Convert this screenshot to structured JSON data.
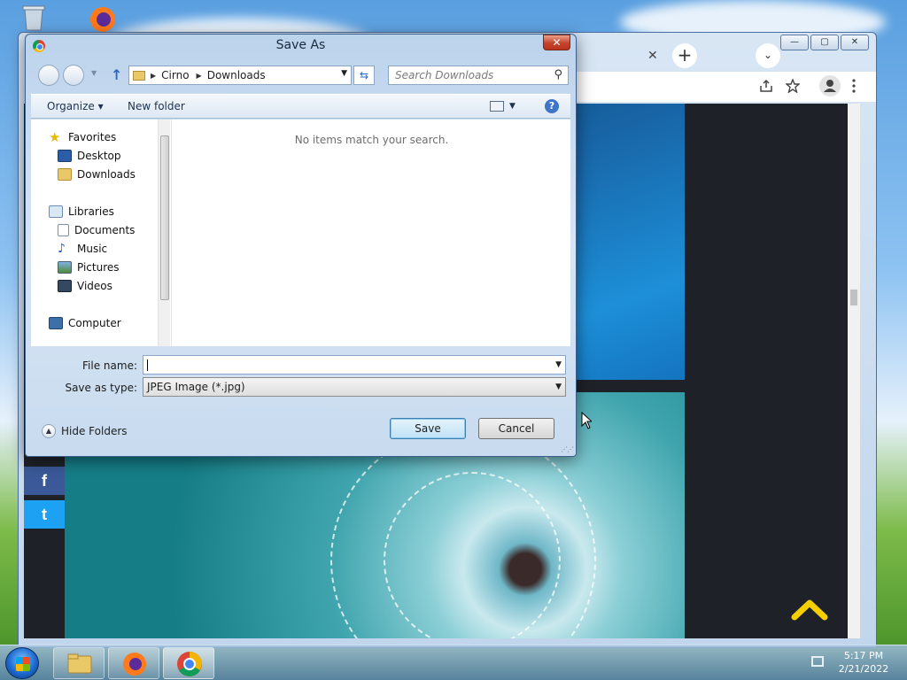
{
  "dialog": {
    "title": "Save As",
    "close_label": "✕",
    "breadcrumb": [
      "Cirno",
      "Downloads"
    ],
    "search_placeholder": "Search Downloads",
    "commands": {
      "organize": "Organize ▾",
      "new_folder": "New folder"
    },
    "help_label": "?",
    "nav": {
      "favorites": "Favorites",
      "desktop": "Desktop",
      "downloads": "Downloads",
      "libraries": "Libraries",
      "documents": "Documents",
      "music": "Music",
      "pictures": "Pictures",
      "videos": "Videos",
      "computer": "Computer"
    },
    "empty_message": "No items match your search.",
    "file_name_label": "File name:",
    "file_name_value": "",
    "save_type_label": "Save as type:",
    "save_type_value": "JPEG Image (*.jpg)",
    "hide_folders": "Hide Folders",
    "save_button": "Save",
    "cancel_button": "Cancel"
  },
  "browser": {
    "caption_buttons": [
      "—",
      "▢",
      "✕"
    ],
    "tab_close": "✕",
    "new_tab": "+",
    "tab_search": "⌄",
    "social": {
      "facebook": "f",
      "twitter": "t"
    }
  },
  "taskbar": {
    "time": "5:17 PM",
    "date": "2/21/2022"
  },
  "colors": {
    "dialog_accent": "#3d5f8e",
    "close_red": "#c4432b",
    "facebook": "#3b5998",
    "twitter": "#1da1f2",
    "chevron_yellow": "#f5cf00"
  }
}
